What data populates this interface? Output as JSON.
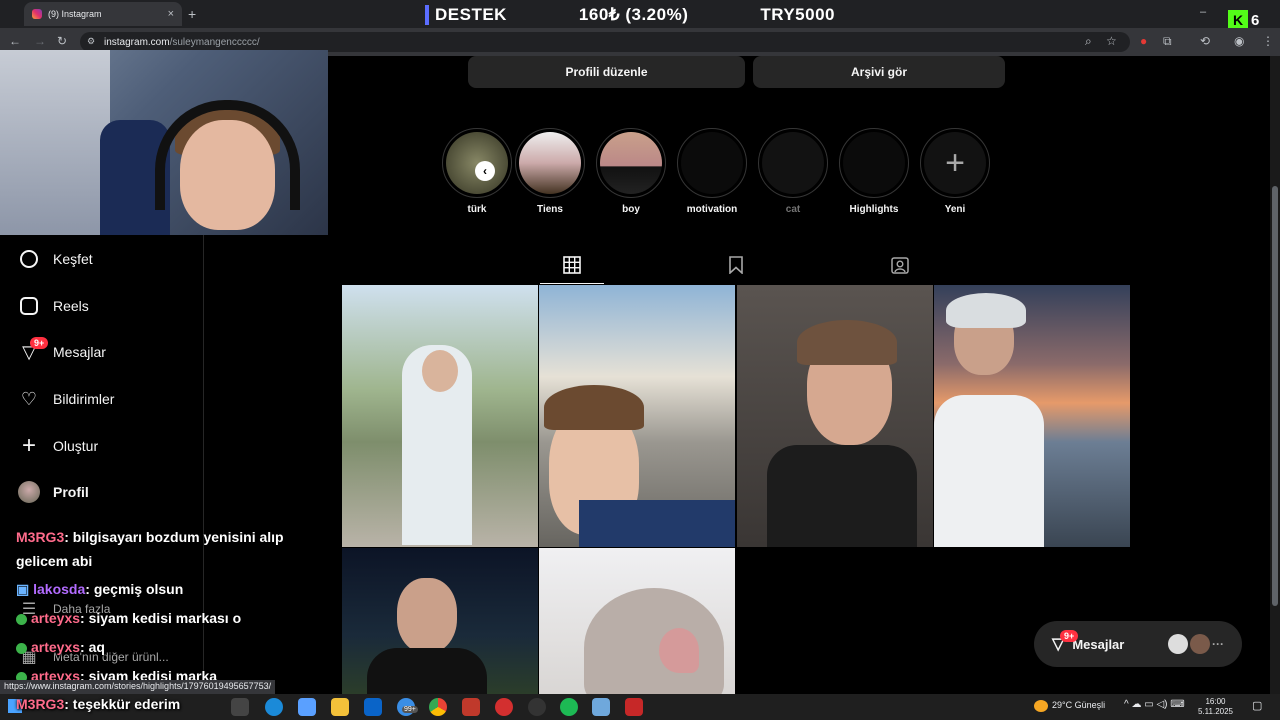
{
  "browser": {
    "tab_title": "(9) Instagram",
    "tab_close": "×",
    "new_tab": "+",
    "url_host": "instagram.com",
    "url_path": "/suleymangenccccc/",
    "status_url": "https://www.instagram.com/stories/highlights/17976019495657753/"
  },
  "stream_overlay": {
    "label": "DESTEK",
    "amount": "160₺ (3.20%)",
    "goal": "TRY5000",
    "kick_logo": "K",
    "viewer_count": "6"
  },
  "window_controls": {
    "minimize": "–",
    "maximize": "□",
    "close": "✕"
  },
  "profile_buttons": {
    "edit": "Profili düzenle",
    "archive": "Arşivi gör"
  },
  "highlights": [
    {
      "label": "türk"
    },
    {
      "label": "Tiens"
    },
    {
      "label": "boy"
    },
    {
      "label": "motivation"
    },
    {
      "label": "cat"
    },
    {
      "label": "Highlights"
    },
    {
      "label": "Yeni"
    }
  ],
  "highlight_prev": "‹",
  "sidebar": {
    "items": [
      {
        "label": "Keşfet",
        "icon": "compass-icon"
      },
      {
        "label": "Reels",
        "icon": "reels-icon"
      },
      {
        "label": "Mesajlar",
        "icon": "messenger-icon"
      },
      {
        "label": "Bildirimler",
        "icon": "heart-icon"
      },
      {
        "label": "Oluştur",
        "icon": "plus-icon"
      },
      {
        "label": "Profil",
        "icon": "avatar"
      }
    ],
    "badge": "9+",
    "more": "Daha fazla",
    "also_from_meta": "Meta'nın diğer ürünl..."
  },
  "chat": [
    {
      "user": "M3RG3",
      "message": ": bilgisayarı bozdum yenisini alıp",
      "color": "#ff6b8b"
    },
    {
      "user": "",
      "message": "gelicem abi",
      "color": "#ffffff"
    },
    {
      "user": "lakosda",
      "message": ": geçmiş olsun",
      "color": "#b26bff"
    },
    {
      "user": "arteyxs",
      "message": ": siyam kedisi markası o",
      "color": "#ff6b8b"
    },
    {
      "user": "arteyxs",
      "message": ": aq",
      "color": "#ff6b8b"
    },
    {
      "user": "arteyxs",
      "message": ": siyam kedisi marka",
      "color": "#ff6b8b"
    },
    {
      "user": "M3RG3",
      "message": ": teşekkür ederim",
      "color": "#ff6b8b"
    }
  ],
  "messages_pill": {
    "label": "Mesajlar",
    "badge": "9+",
    "more": "···"
  },
  "taskbar": {
    "weather": "29°C  Güneşli",
    "time": "16:00",
    "date": "5.11.2025",
    "badge": "99+"
  }
}
